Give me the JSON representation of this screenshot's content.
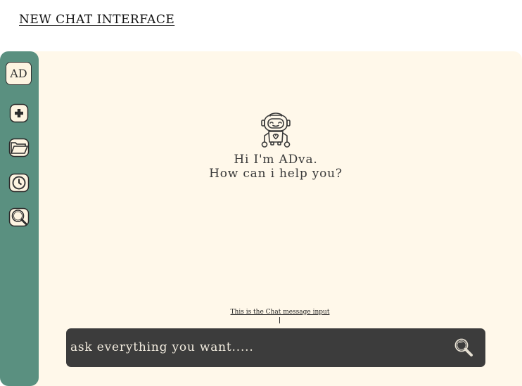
{
  "header": {
    "title": "NEW CHAT INTERFACE"
  },
  "sidebar": {
    "avatar_initials": "AD",
    "items": [
      {
        "name": "new-chat",
        "icon": "plus-icon"
      },
      {
        "name": "folders",
        "icon": "folder-icon"
      },
      {
        "name": "history",
        "icon": "clock-icon"
      },
      {
        "name": "search",
        "icon": "search-icon"
      }
    ]
  },
  "main": {
    "greeting_line1": "Hi I'm ADva.",
    "greeting_line2": "How can i help you?",
    "annotation": "This is the Chat message input",
    "input_placeholder": "ask everything you want.....",
    "send_icon": "search-icon"
  },
  "colors": {
    "sidebar": "#5a9080",
    "background": "#fff8ea",
    "input_bar": "#3c3c3c",
    "input_text": "#f2ecdf"
  }
}
